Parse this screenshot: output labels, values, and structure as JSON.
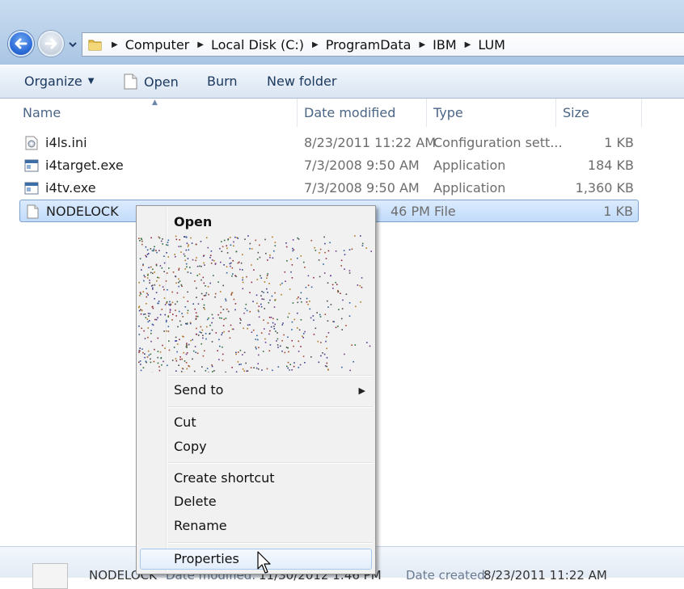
{
  "address": {
    "segments": [
      "Computer",
      "Local Disk (C:)",
      "ProgramData",
      "IBM",
      "LUM"
    ]
  },
  "toolbar": {
    "organize_label": "Organize",
    "open_label": "Open",
    "burn_label": "Burn",
    "new_folder_label": "New folder"
  },
  "columns": {
    "name": "Name",
    "date_modified": "Date modified",
    "type": "Type",
    "size": "Size"
  },
  "files": [
    {
      "name": "i4ls.ini",
      "date": "8/23/2011 11:22 AM",
      "type": "Configuration sett...",
      "size": "1 KB",
      "icon": "settings-file-icon"
    },
    {
      "name": "i4target.exe",
      "date": "7/3/2008 9:50 AM",
      "type": "Application",
      "size": "184 KB",
      "icon": "application-icon"
    },
    {
      "name": "i4tv.exe",
      "date": "7/3/2008 9:50 AM",
      "type": "Application",
      "size": "1,360 KB",
      "icon": "application-icon"
    },
    {
      "name": "NODELOCK",
      "date_partial": "46 PM",
      "type": "File",
      "size": "1 KB",
      "icon": "blank-file-icon",
      "selected": true
    }
  ],
  "context_menu": {
    "open": "Open",
    "send_to": "Send to",
    "cut": "Cut",
    "copy": "Copy",
    "create_shortcut": "Create shortcut",
    "delete": "Delete",
    "rename": "Rename",
    "properties": "Properties"
  },
  "details": {
    "name": "NODELOCK",
    "date_modified_label": "Date modified:",
    "date_modified_value": "11/30/2012 1:46 PM",
    "date_created_label": "Date created:",
    "date_created_value": "8/23/2011 11:22 AM"
  },
  "colors": {
    "selection": "#c1dcfc",
    "selection_border": "#7da2ce",
    "command_text": "#1c3a60",
    "column_header_text": "#4b6585",
    "menu_background": "#f1f1f1"
  }
}
